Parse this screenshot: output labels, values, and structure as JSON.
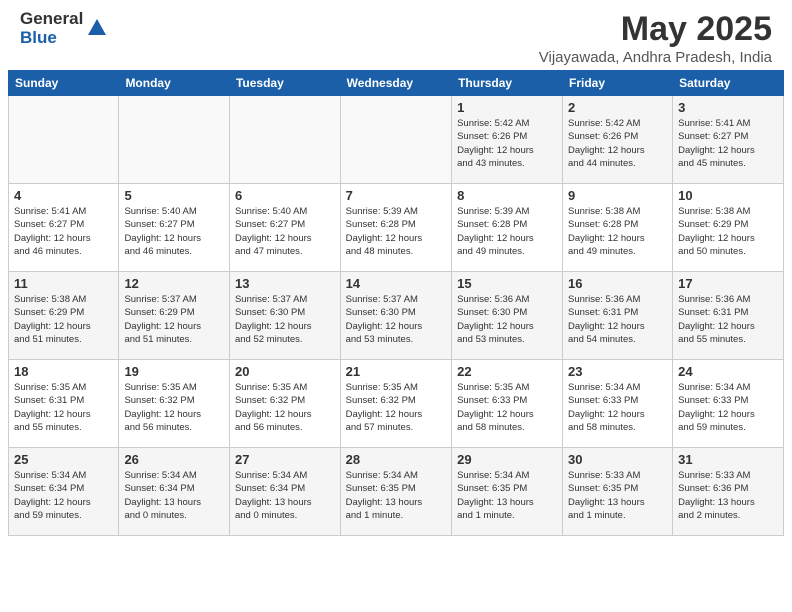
{
  "header": {
    "logo_general": "General",
    "logo_blue": "Blue",
    "month_title": "May 2025",
    "location": "Vijayawada, Andhra Pradesh, India"
  },
  "weekdays": [
    "Sunday",
    "Monday",
    "Tuesday",
    "Wednesday",
    "Thursday",
    "Friday",
    "Saturday"
  ],
  "weeks": [
    [
      {
        "day": "",
        "info": ""
      },
      {
        "day": "",
        "info": ""
      },
      {
        "day": "",
        "info": ""
      },
      {
        "day": "",
        "info": ""
      },
      {
        "day": "1",
        "info": "Sunrise: 5:42 AM\nSunset: 6:26 PM\nDaylight: 12 hours\nand 43 minutes."
      },
      {
        "day": "2",
        "info": "Sunrise: 5:42 AM\nSunset: 6:26 PM\nDaylight: 12 hours\nand 44 minutes."
      },
      {
        "day": "3",
        "info": "Sunrise: 5:41 AM\nSunset: 6:27 PM\nDaylight: 12 hours\nand 45 minutes."
      }
    ],
    [
      {
        "day": "4",
        "info": "Sunrise: 5:41 AM\nSunset: 6:27 PM\nDaylight: 12 hours\nand 46 minutes."
      },
      {
        "day": "5",
        "info": "Sunrise: 5:40 AM\nSunset: 6:27 PM\nDaylight: 12 hours\nand 46 minutes."
      },
      {
        "day": "6",
        "info": "Sunrise: 5:40 AM\nSunset: 6:27 PM\nDaylight: 12 hours\nand 47 minutes."
      },
      {
        "day": "7",
        "info": "Sunrise: 5:39 AM\nSunset: 6:28 PM\nDaylight: 12 hours\nand 48 minutes."
      },
      {
        "day": "8",
        "info": "Sunrise: 5:39 AM\nSunset: 6:28 PM\nDaylight: 12 hours\nand 49 minutes."
      },
      {
        "day": "9",
        "info": "Sunrise: 5:38 AM\nSunset: 6:28 PM\nDaylight: 12 hours\nand 49 minutes."
      },
      {
        "day": "10",
        "info": "Sunrise: 5:38 AM\nSunset: 6:29 PM\nDaylight: 12 hours\nand 50 minutes."
      }
    ],
    [
      {
        "day": "11",
        "info": "Sunrise: 5:38 AM\nSunset: 6:29 PM\nDaylight: 12 hours\nand 51 minutes."
      },
      {
        "day": "12",
        "info": "Sunrise: 5:37 AM\nSunset: 6:29 PM\nDaylight: 12 hours\nand 51 minutes."
      },
      {
        "day": "13",
        "info": "Sunrise: 5:37 AM\nSunset: 6:30 PM\nDaylight: 12 hours\nand 52 minutes."
      },
      {
        "day": "14",
        "info": "Sunrise: 5:37 AM\nSunset: 6:30 PM\nDaylight: 12 hours\nand 53 minutes."
      },
      {
        "day": "15",
        "info": "Sunrise: 5:36 AM\nSunset: 6:30 PM\nDaylight: 12 hours\nand 53 minutes."
      },
      {
        "day": "16",
        "info": "Sunrise: 5:36 AM\nSunset: 6:31 PM\nDaylight: 12 hours\nand 54 minutes."
      },
      {
        "day": "17",
        "info": "Sunrise: 5:36 AM\nSunset: 6:31 PM\nDaylight: 12 hours\nand 55 minutes."
      }
    ],
    [
      {
        "day": "18",
        "info": "Sunrise: 5:35 AM\nSunset: 6:31 PM\nDaylight: 12 hours\nand 55 minutes."
      },
      {
        "day": "19",
        "info": "Sunrise: 5:35 AM\nSunset: 6:32 PM\nDaylight: 12 hours\nand 56 minutes."
      },
      {
        "day": "20",
        "info": "Sunrise: 5:35 AM\nSunset: 6:32 PM\nDaylight: 12 hours\nand 56 minutes."
      },
      {
        "day": "21",
        "info": "Sunrise: 5:35 AM\nSunset: 6:32 PM\nDaylight: 12 hours\nand 57 minutes."
      },
      {
        "day": "22",
        "info": "Sunrise: 5:35 AM\nSunset: 6:33 PM\nDaylight: 12 hours\nand 58 minutes."
      },
      {
        "day": "23",
        "info": "Sunrise: 5:34 AM\nSunset: 6:33 PM\nDaylight: 12 hours\nand 58 minutes."
      },
      {
        "day": "24",
        "info": "Sunrise: 5:34 AM\nSunset: 6:33 PM\nDaylight: 12 hours\nand 59 minutes."
      }
    ],
    [
      {
        "day": "25",
        "info": "Sunrise: 5:34 AM\nSunset: 6:34 PM\nDaylight: 12 hours\nand 59 minutes."
      },
      {
        "day": "26",
        "info": "Sunrise: 5:34 AM\nSunset: 6:34 PM\nDaylight: 13 hours\nand 0 minutes."
      },
      {
        "day": "27",
        "info": "Sunrise: 5:34 AM\nSunset: 6:34 PM\nDaylight: 13 hours\nand 0 minutes."
      },
      {
        "day": "28",
        "info": "Sunrise: 5:34 AM\nSunset: 6:35 PM\nDaylight: 13 hours\nand 1 minute."
      },
      {
        "day": "29",
        "info": "Sunrise: 5:34 AM\nSunset: 6:35 PM\nDaylight: 13 hours\nand 1 minute."
      },
      {
        "day": "30",
        "info": "Sunrise: 5:33 AM\nSunset: 6:35 PM\nDaylight: 13 hours\nand 1 minute."
      },
      {
        "day": "31",
        "info": "Sunrise: 5:33 AM\nSunset: 6:36 PM\nDaylight: 13 hours\nand 2 minutes."
      }
    ]
  ]
}
